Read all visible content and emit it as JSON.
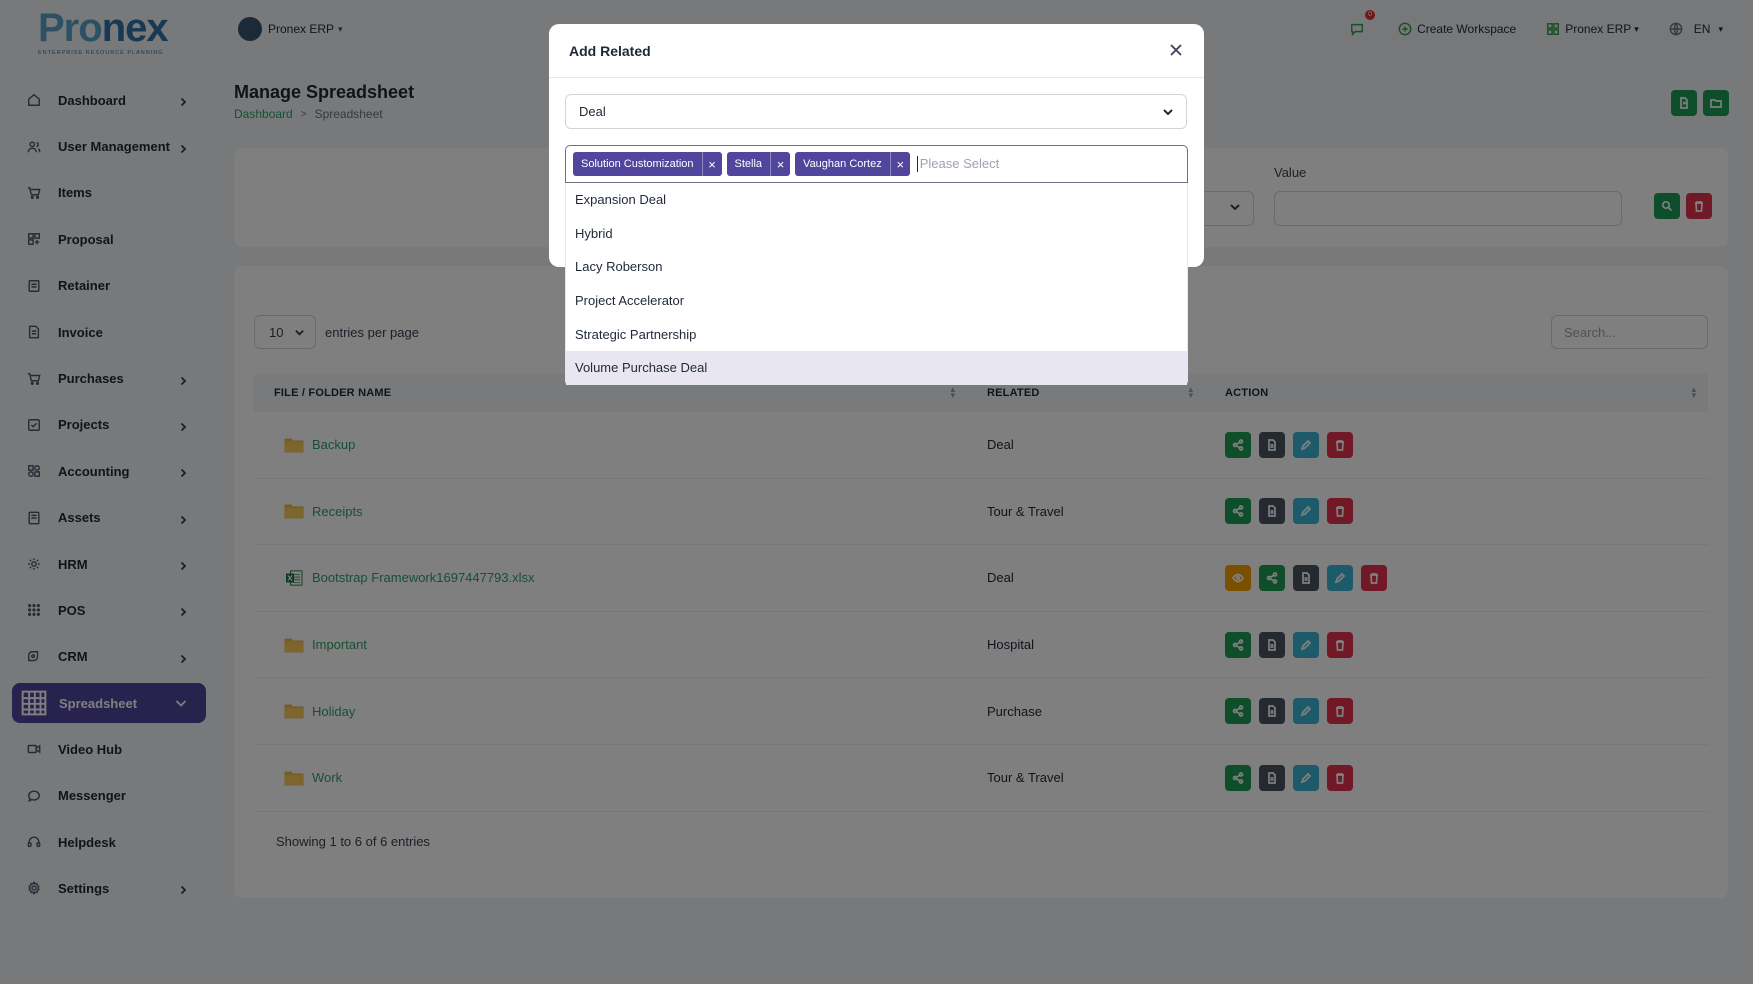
{
  "brand": {
    "logo_main_a": "Pro",
    "logo_main_b": "nex",
    "logo_sub": "ENTERPRISE RESOURCE PLANNING"
  },
  "workspace_switch": {
    "label": "Pronex ERP"
  },
  "topbar": {
    "notification_count": "0",
    "create_workspace": "Create Workspace",
    "workspace": "Pronex ERP",
    "language": "EN"
  },
  "sidebar": {
    "items": [
      {
        "label": "Dashboard",
        "icon": "home-icon",
        "chevron": true
      },
      {
        "label": "User Management",
        "icon": "users-icon",
        "chevron": true
      },
      {
        "label": "Items",
        "icon": "cart-icon",
        "chevron": false
      },
      {
        "label": "Proposal",
        "icon": "proposal-icon",
        "chevron": false
      },
      {
        "label": "Retainer",
        "icon": "retainer-icon",
        "chevron": false
      },
      {
        "label": "Invoice",
        "icon": "invoice-icon",
        "chevron": false
      },
      {
        "label": "Purchases",
        "icon": "cart-icon",
        "chevron": true
      },
      {
        "label": "Projects",
        "icon": "projects-icon",
        "chevron": true
      },
      {
        "label": "Accounting",
        "icon": "accounting-icon",
        "chevron": true
      },
      {
        "label": "Assets",
        "icon": "assets-icon",
        "chevron": true
      },
      {
        "label": "HRM",
        "icon": "hrm-icon",
        "chevron": true
      },
      {
        "label": "POS",
        "icon": "grid-icon",
        "chevron": true
      },
      {
        "label": "CRM",
        "icon": "crm-icon",
        "chevron": true
      },
      {
        "label": "Spreadsheet",
        "icon": "spreadsheet-icon",
        "chevron": true,
        "active": true
      },
      {
        "label": "Video Hub",
        "icon": "video-icon",
        "chevron": false
      },
      {
        "label": "Messenger",
        "icon": "chat-icon",
        "chevron": false
      },
      {
        "label": "Helpdesk",
        "icon": "headset-icon",
        "chevron": false
      },
      {
        "label": "Settings",
        "icon": "gear-icon",
        "chevron": true
      }
    ]
  },
  "page": {
    "title": "Manage Spreadsheet",
    "breadcrumb": {
      "home": "Dashboard",
      "separator": ">",
      "current": "Spreadsheet"
    }
  },
  "filter": {
    "value_label": "Value"
  },
  "table": {
    "entries_per_page_value": "10",
    "entries_per_page_label": "entries per page",
    "search_placeholder": "Search...",
    "columns": {
      "name": "FILE / FOLDER NAME",
      "related": "RELATED",
      "action": "ACTION"
    },
    "rows": [
      {
        "name": "Backup",
        "type": "folder",
        "related": "Deal"
      },
      {
        "name": "Receipts",
        "type": "folder",
        "related": "Tour & Travel"
      },
      {
        "name": "Bootstrap Framework1697447793.xlsx",
        "type": "excel",
        "related": "Deal"
      },
      {
        "name": "Important",
        "type": "folder",
        "related": "Hospital"
      },
      {
        "name": "Holiday",
        "type": "folder",
        "related": "Purchase"
      },
      {
        "name": "Work",
        "type": "folder",
        "related": "Tour & Travel"
      }
    ],
    "footer": "Showing 1 to 6 of 6 entries"
  },
  "modal": {
    "title": "Add Related",
    "type_select_value": "Deal",
    "selected_tags": [
      "Solution Customization",
      "Stella",
      "Vaughan Cortez"
    ],
    "multi_placeholder": "Please Select",
    "tag_remove_glyph": "×",
    "options": [
      "Expansion Deal",
      "Hybrid",
      "Lacy Roberson",
      "Project Accelerator",
      "Strategic Partnership",
      "Volume Purchase Deal"
    ],
    "highlighted_option": "Volume Purchase Deal"
  },
  "colors": {
    "primary": "#51459d",
    "success": "#1f9d55",
    "link": "#2f9e6a",
    "danger": "#e2334f",
    "info": "#3bb6d4",
    "dark": "#4b5563",
    "warning": "#f59f00"
  }
}
